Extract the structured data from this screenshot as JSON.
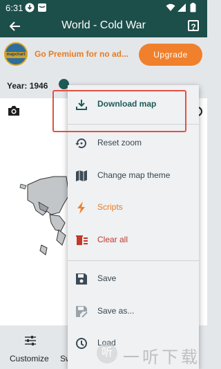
{
  "status_bar": {
    "time": "6:31"
  },
  "app_bar": {
    "title": "World - Cold War",
    "help_icon_char": "?"
  },
  "promo": {
    "logo_text": "mapchart",
    "text": "Go Premium for no ad...",
    "upgrade_label": "Upgrade"
  },
  "timeline": {
    "year_label": "Year: 1946"
  },
  "bottom_bar": {
    "customize_label": "Customize",
    "second_label": "Sw"
  },
  "menu": {
    "download": "Download map",
    "reset_zoom": "Reset zoom",
    "change_theme": "Change map theme",
    "scripts": "Scripts",
    "clear_all": "Clear all",
    "save": "Save",
    "save_as": "Save as...",
    "load": "Load"
  },
  "colors": {
    "appbar": "#1c4e4a",
    "accent_orange": "#f0802b",
    "clear_red": "#c0392b",
    "download_teal": "#1f5a57",
    "highlight_red": "#e35141"
  },
  "watermark": {
    "logo_char": "听",
    "text": "一听下载"
  }
}
